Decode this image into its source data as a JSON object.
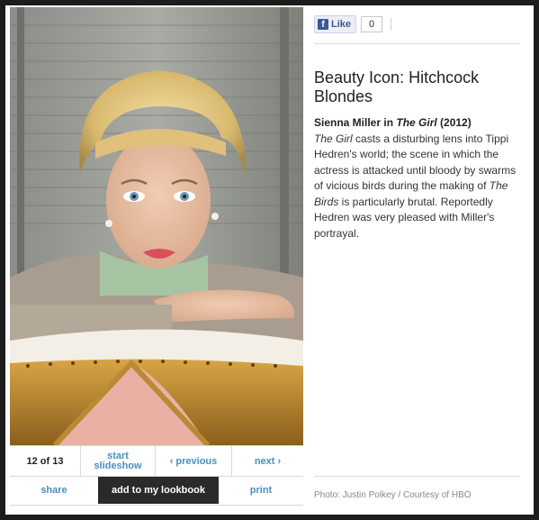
{
  "slideshow": {
    "counter": "12 of 13",
    "start_label_line1": "start",
    "start_label_line2": "slideshow",
    "previous_label": "‹ previous",
    "next_label": "next ›",
    "share_label": "share",
    "lookbook_label": "add to my lookbook",
    "print_label": "print"
  },
  "facebook": {
    "icon_letter": "f",
    "like_label": "Like",
    "count": "0"
  },
  "article": {
    "title": "Beauty Icon: Hitchcock Blondes",
    "caption_bold_1": "Sienna Miller in ",
    "caption_bold_italic": "The Girl",
    "caption_bold_2": " (2012)",
    "body_italic_1": "The Girl",
    "body_1": " casts a disturbing lens into Tippi Hedren's world; the scene in which the actress is attacked until bloody by swarms of vicious birds during the making of ",
    "body_italic_2": "The Birds",
    "body_2": " is particularly brutal. Reportedly Hedren was very pleased with Miller's portrayal.",
    "credit": "Photo: Justin Polkey / Courtesy of HBO"
  },
  "colors": {
    "link": "#4a8fbf",
    "dark_button": "#2a2a2a",
    "frame": "#1c1c1c"
  }
}
